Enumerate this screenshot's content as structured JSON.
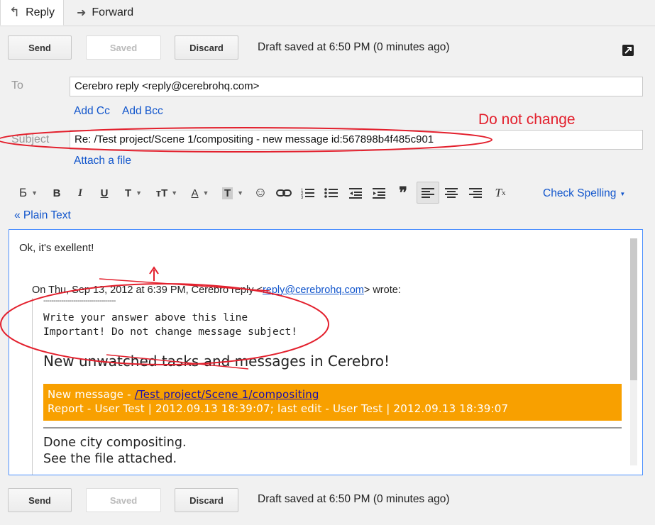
{
  "tabs": {
    "reply": "Reply",
    "forward": "Forward"
  },
  "toolbar": {
    "send": "Send",
    "saved": "Saved",
    "discard": "Discard",
    "status": "Draft saved at 6:50 PM (0 minutes ago)"
  },
  "fields": {
    "to_label": "To",
    "to_value": "Cerebro reply <reply@cerebrohq.com>",
    "add_cc": "Add Cc",
    "add_bcc": "Add Bcc",
    "subject_label": "Subject",
    "subject_value": "Re: /Test project/Scene 1/compositing - new message id:567898b4f485c901",
    "attach": "Attach a file"
  },
  "formatting": {
    "font": "Б",
    "bold": "B",
    "italic": "I",
    "underline": "U",
    "size": "T",
    "size2": "тT",
    "textcolor": "A",
    "highlight": "T",
    "check_spelling": "Check Spelling",
    "plain_text": "« Plain Text"
  },
  "body": {
    "reply_text": "Ok, it's exellent!",
    "quote_header_prefix": "On Thu, Sep 13, 2012 at 6:39 PM, Cerebro reply <",
    "quote_header_email": "reply@cerebrohq.com",
    "quote_header_suffix": "> wrote:",
    "separator": "------------------------------------",
    "line1": "Write your answer above this line",
    "line2": "Important! Do not change message subject!",
    "heading": "New unwatched tasks and messages in Cerebro!",
    "new_message_label": "New message - ",
    "new_message_link": "/Test project/Scene 1/compositing",
    "report_line": "Report - User Test | 2012.09.13 18:39:07; last edit - User Test | 2012.09.13 18:39:07",
    "done1": "Done city compositing.",
    "done2": "See the file attached."
  },
  "annotation": {
    "do_not_change": "Do not change"
  },
  "colors": {
    "accent": "#1155cc",
    "annotation": "#e3202d",
    "orange": "#f8a000",
    "focus": "#4d90fe"
  }
}
